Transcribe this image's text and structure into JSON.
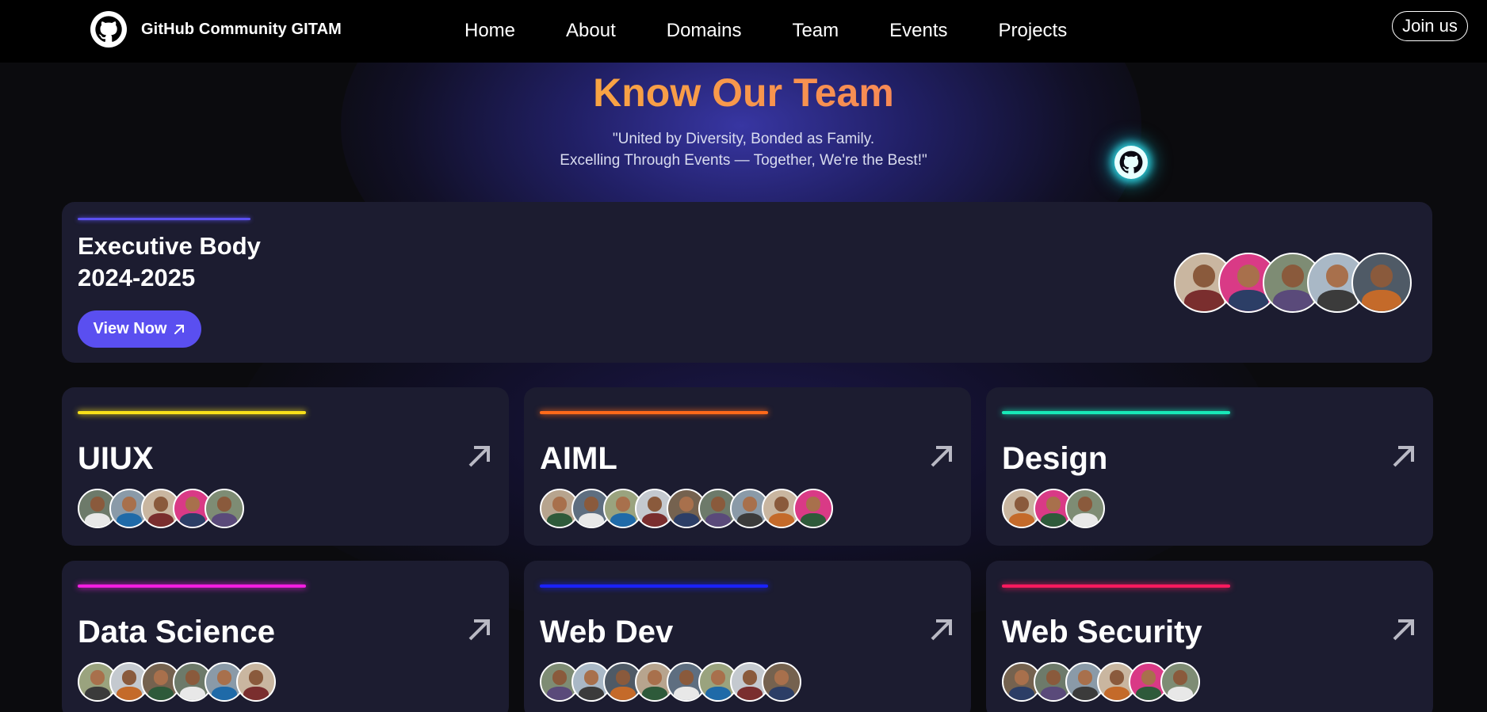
{
  "navbar": {
    "brand": "GitHub Community GITAM",
    "links": [
      "Home",
      "About",
      "Domains",
      "Team",
      "Events",
      "Projects"
    ],
    "join_label": "Join us"
  },
  "hero": {
    "title": "Know Our Team",
    "subtitle_line1": "\"United by Diversity, Bonded as Family.",
    "subtitle_line2": "Excelling Through Events — Together, We're the Best!\""
  },
  "executive": {
    "title_line1": "Executive Body",
    "title_line2": "2024-2025",
    "button_label": "View Now",
    "accent": "#5b50f0",
    "avatar_count": 5
  },
  "domains": [
    {
      "name": "UIUX",
      "accent": "#f8e01a",
      "avatar_count": 5
    },
    {
      "name": "AIML",
      "accent": "#ff6a1a",
      "avatar_count": 9
    },
    {
      "name": "Design",
      "accent": "#18e8b8",
      "avatar_count": 3
    },
    {
      "name": "Data Science",
      "accent": "#f21ee0",
      "avatar_count": 6
    },
    {
      "name": "Web Dev",
      "accent": "#1a22ff",
      "avatar_count": 8
    },
    {
      "name": "Web Security",
      "accent": "#ff1a5e",
      "avatar_count": 6
    }
  ],
  "icons": {
    "brand": "github-icon",
    "floating": "github-icon",
    "card_arrow": "arrow-up-right-icon"
  }
}
